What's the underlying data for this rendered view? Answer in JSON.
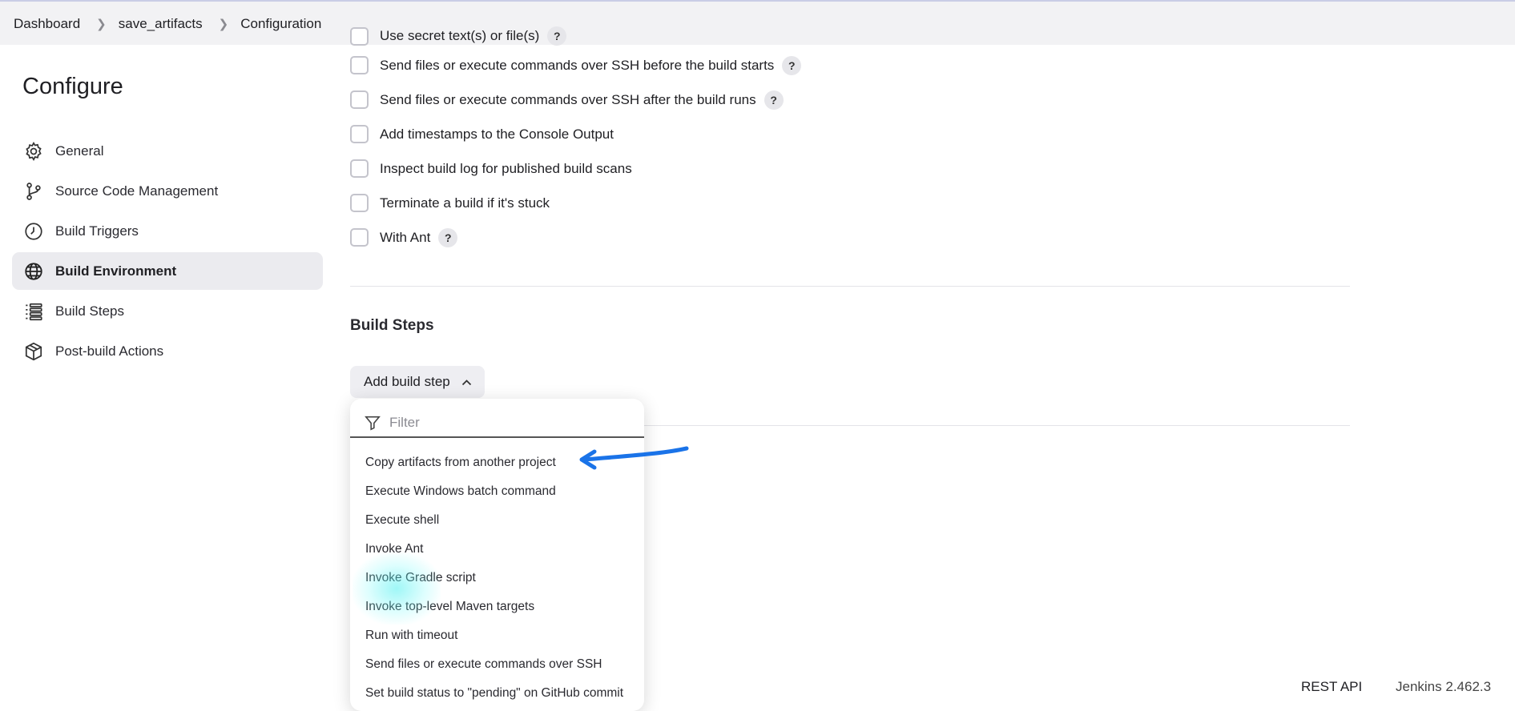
{
  "breadcrumb": {
    "items": [
      "Dashboard",
      "save_artifacts",
      "Configuration"
    ]
  },
  "sidebar": {
    "title": "Configure",
    "items": [
      {
        "label": "General",
        "icon": "gear-icon"
      },
      {
        "label": "Source Code Management",
        "icon": "branch-icon"
      },
      {
        "label": "Build Triggers",
        "icon": "clock-icon"
      },
      {
        "label": "Build Environment",
        "icon": "globe-icon",
        "active": true
      },
      {
        "label": "Build Steps",
        "icon": "list-icon"
      },
      {
        "label": "Post-build Actions",
        "icon": "package-icon"
      }
    ]
  },
  "build_environment": {
    "options": [
      {
        "label": "Use secret text(s) or file(s)",
        "help": "?"
      },
      {
        "label": "Send files or execute commands over SSH before the build starts",
        "help": "?"
      },
      {
        "label": "Send files or execute commands over SSH after the build runs",
        "help": "?"
      },
      {
        "label": "Add timestamps to the Console Output"
      },
      {
        "label": "Inspect build log for published build scans"
      },
      {
        "label": "Terminate a build if it's stuck"
      },
      {
        "label": "With Ant",
        "help": "?"
      }
    ]
  },
  "build_steps": {
    "title": "Build Steps",
    "add_button": "Add build step",
    "filter_placeholder": "Filter",
    "menu": [
      "Copy artifacts from another project",
      "Execute Windows batch command",
      "Execute shell",
      "Invoke Ant",
      "Invoke Gradle script",
      "Invoke top-level Maven targets",
      "Run with timeout",
      "Send files or execute commands over SSH",
      "Set build status to \"pending\" on GitHub commit"
    ]
  },
  "footer": {
    "rest_api": "REST API",
    "version": "Jenkins 2.462.3"
  },
  "colors": {
    "accent_arrow": "#1a73e8",
    "active_bg": "#ebebef"
  }
}
